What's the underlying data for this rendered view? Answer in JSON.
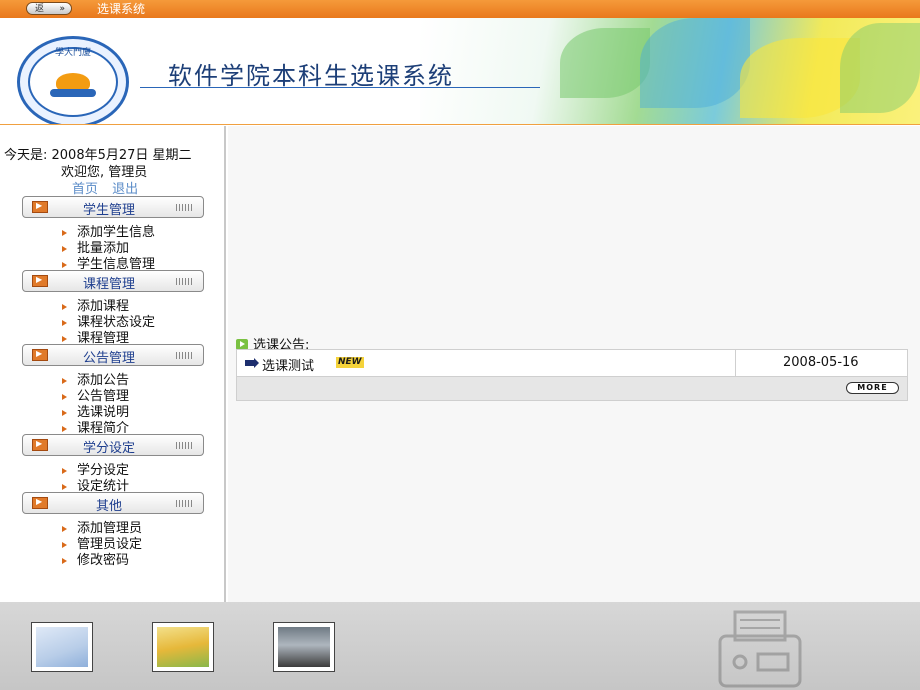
{
  "window": {
    "tab_label": "返",
    "title": "选课系统"
  },
  "banner": {
    "system_title": "软件学院本科生选课系统",
    "logo_text": "學大門廈"
  },
  "sidebar": {
    "date_text": "今天是: 2008年5月27日  星期二",
    "welcome_text": "欢迎您, 管理员",
    "links": [
      "首页",
      "退出"
    ],
    "sections": [
      {
        "label": "学生管理",
        "items": [
          "添加学生信息",
          "批量添加",
          "学生信息管理"
        ]
      },
      {
        "label": "课程管理",
        "items": [
          "添加课程",
          "课程状态设定",
          "课程管理"
        ]
      },
      {
        "label": "公告管理",
        "items": [
          "添加公告",
          "公告管理",
          "选课说明",
          "课程简介"
        ]
      },
      {
        "label": "学分设定",
        "items": [
          "学分设定",
          "设定统计"
        ]
      },
      {
        "label": "其他",
        "items": [
          "添加管理员",
          "管理员设定",
          "修改密码"
        ]
      }
    ]
  },
  "main": {
    "announcements_title": "选课公告:",
    "announcements": [
      {
        "title": "选课测试",
        "badge": "NEW",
        "date": "2008-05-16"
      }
    ],
    "more_label": "MORE"
  },
  "colors": {
    "accent": "#e9781c",
    "nav_text": "#1f3f8f",
    "link": "#5b8cc8"
  },
  "icons": [
    "documents-icon",
    "folders-icon",
    "laptop-icon",
    "section-arrow-icon",
    "bullet-triangle-icon"
  ]
}
